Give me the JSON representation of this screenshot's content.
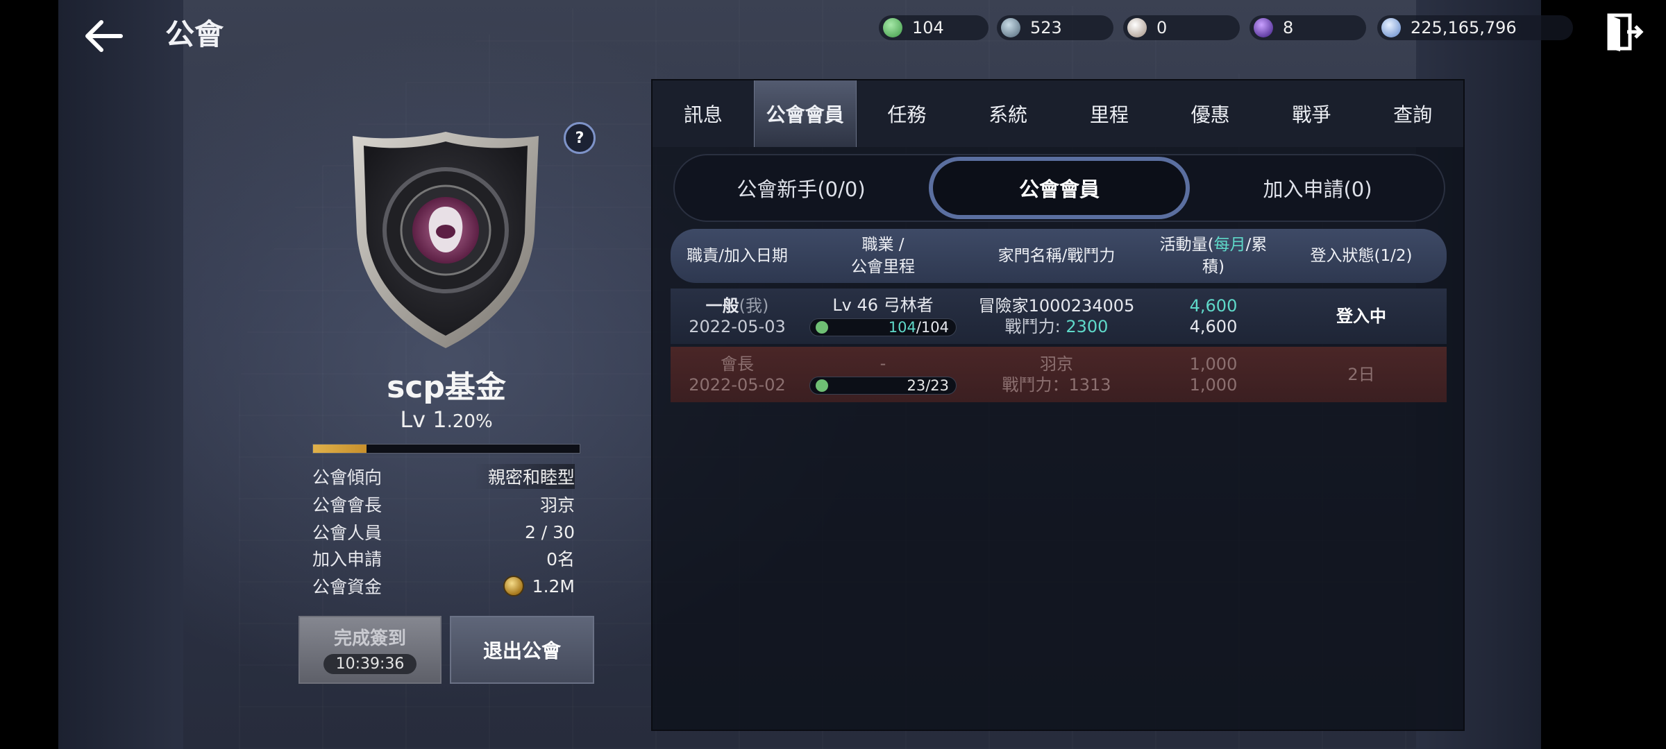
{
  "header": {
    "title": "公會",
    "currencies": [
      {
        "icon": "mileage-icon",
        "value": "104",
        "color": "#5fbf6a"
      },
      {
        "icon": "crystal-icon",
        "value": "523",
        "color": "#8aa6b8"
      },
      {
        "icon": "pearl-icon",
        "value": "0",
        "color": "#d6c7b8"
      },
      {
        "icon": "soul-gem-icon",
        "value": "8",
        "color": "#7a48d6"
      },
      {
        "icon": "silver-coin-icon",
        "value": "225,165,796",
        "color": "#9ab8e8"
      }
    ]
  },
  "guild": {
    "name": "scp基金",
    "level": "Lv 1",
    "level_pct": ".20%",
    "exp_fraction": 0.2,
    "info": [
      {
        "key": "公會傾向",
        "value": "親密和睦型"
      },
      {
        "key": "公會會長",
        "value": "羽京"
      },
      {
        "key": "公會人員",
        "value": "2 / 30"
      },
      {
        "key": "加入申請",
        "value": "0名"
      },
      {
        "key": "公會資金",
        "value": "1.2M"
      }
    ],
    "checkin_label": "完成簽到",
    "checkin_timer": "10:39:36",
    "leave_label": "退出公會"
  },
  "tabs": [
    "訊息",
    "公會會員",
    "任務",
    "系統",
    "里程",
    "優惠",
    "戰爭",
    "查詢"
  ],
  "subtabs": [
    "公會新手(0/0)",
    "公會會員",
    "加入申請(0)"
  ],
  "table": {
    "headers": {
      "role": "職責/加入日期",
      "job_line1": "職業 /",
      "job_line2": "公會里程",
      "family": "家門名稱/戰鬥力",
      "activity_prefix": "活動量(",
      "activity_hl": "每月",
      "activity_suffix": "/累積)",
      "login": "登入狀態(1/2)"
    },
    "rows": [
      {
        "role": "一般",
        "role_tag": "(我)",
        "date": "2022-05-03",
        "job": "Lv 46 弓林者",
        "mileage_cur": "104",
        "mileage_max": "/104",
        "family": "冒險家1000234005",
        "power_label": "戰鬥力: ",
        "power": "2300",
        "activity_month": "4,600",
        "activity_total": "4,600",
        "login": "登入中"
      },
      {
        "role": "會長",
        "role_tag": "",
        "date": "2022-05-02",
        "job": "-",
        "mileage_cur": "23",
        "mileage_max": "/23",
        "family": "羽京",
        "power_label": "戰鬥力：",
        "power": "1313",
        "activity_month": "1,000",
        "activity_total": "1,000",
        "login": "2日"
      }
    ]
  }
}
